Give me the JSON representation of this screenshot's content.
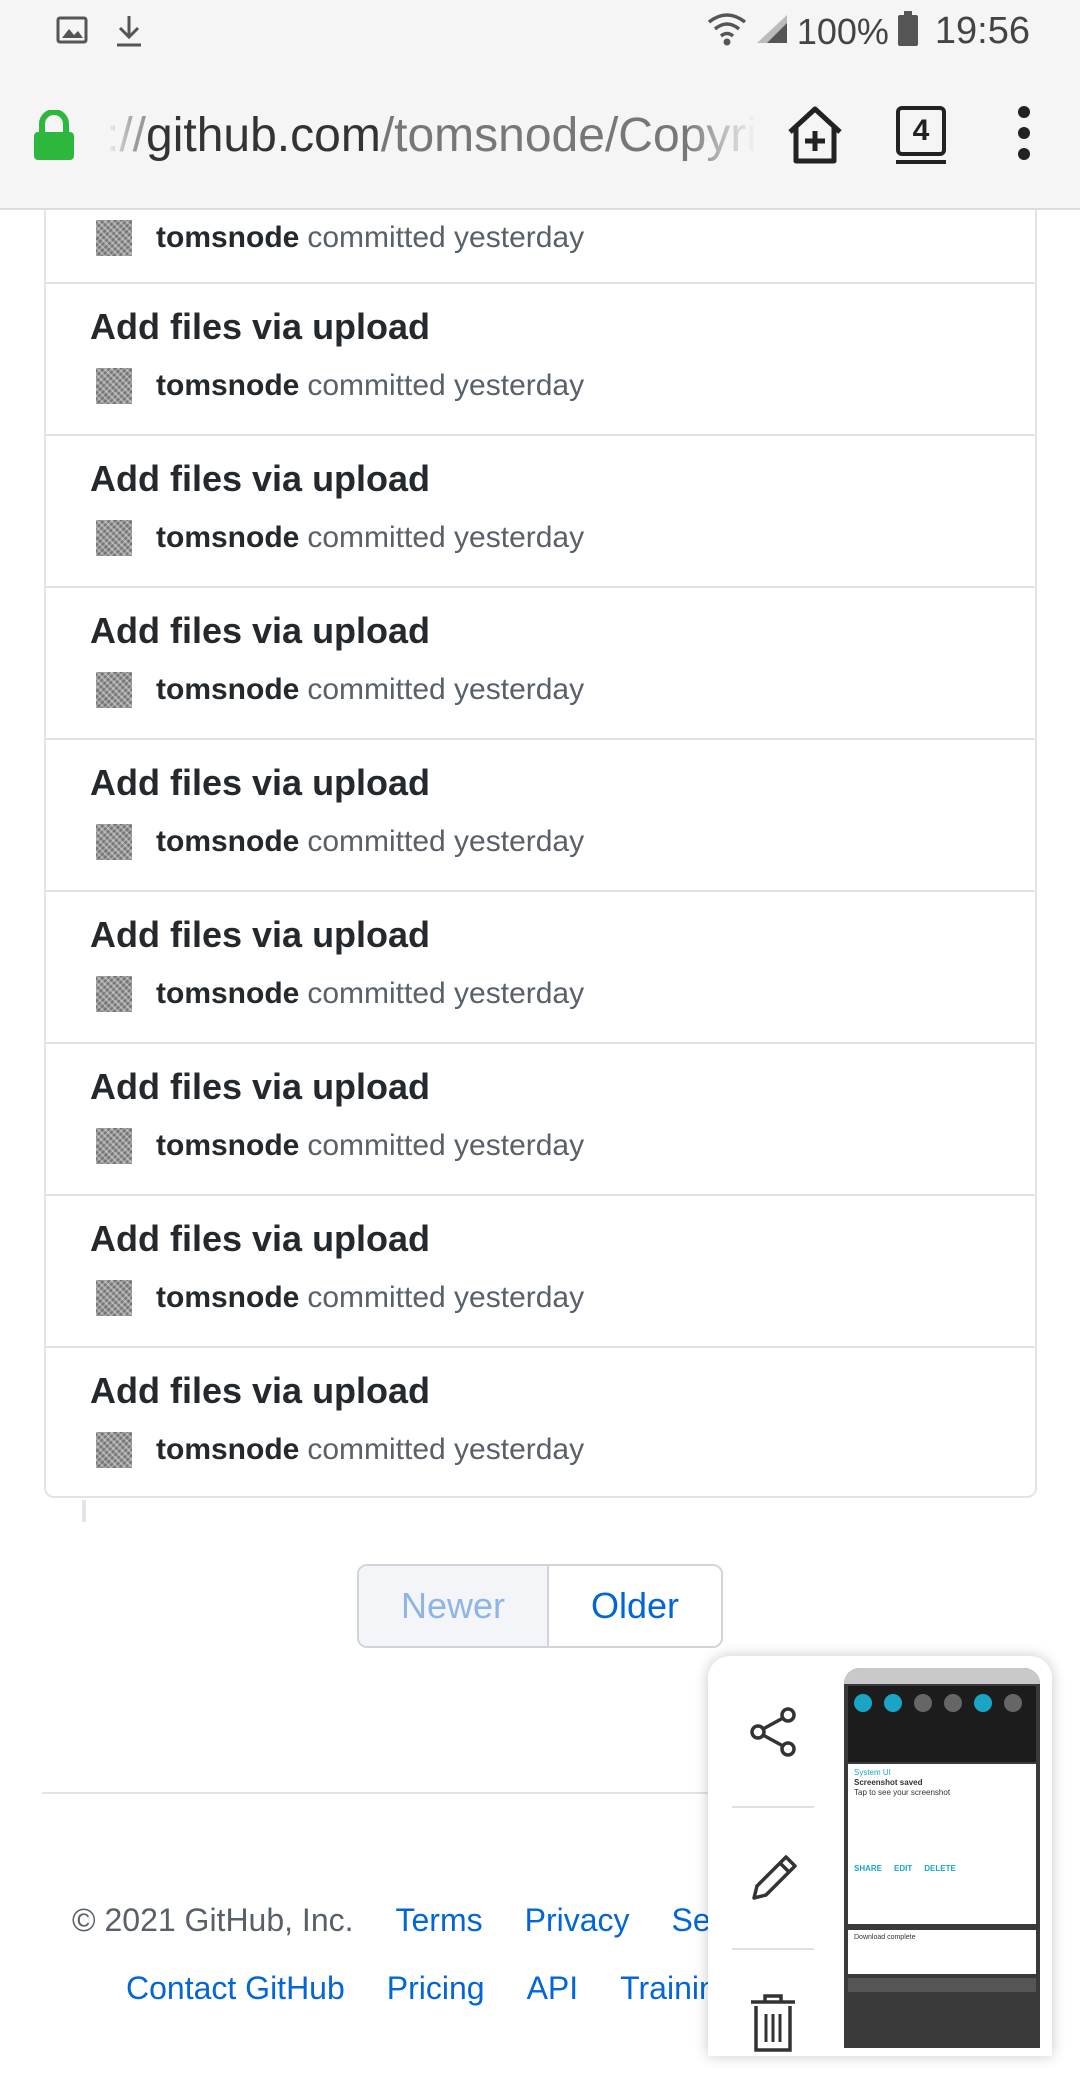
{
  "status_bar": {
    "battery": "100%",
    "time": "19:56"
  },
  "browser": {
    "url_prefix": "://",
    "url_host": "github.com",
    "url_path": "/tomsnode/Copyri",
    "tab_count": "4"
  },
  "commits": {
    "first_partial": {
      "author": "tomsnode",
      "committed": "committed yesterday"
    },
    "items": [
      {
        "title": "Add files via upload",
        "author": "tomsnode",
        "committed": "committed yesterday"
      },
      {
        "title": "Add files via upload",
        "author": "tomsnode",
        "committed": "committed yesterday"
      },
      {
        "title": "Add files via upload",
        "author": "tomsnode",
        "committed": "committed yesterday"
      },
      {
        "title": "Add files via upload",
        "author": "tomsnode",
        "committed": "committed yesterday"
      },
      {
        "title": "Add files via upload",
        "author": "tomsnode",
        "committed": "committed yesterday"
      },
      {
        "title": "Add files via upload",
        "author": "tomsnode",
        "committed": "committed yesterday"
      },
      {
        "title": "Add files via upload",
        "author": "tomsnode",
        "committed": "committed yesterday"
      },
      {
        "title": "Add files via upload",
        "author": "tomsnode",
        "committed": "committed yesterday"
      }
    ]
  },
  "pagination": {
    "newer": "Newer",
    "older": "Older"
  },
  "footer": {
    "copyright": "© 2021 GitHub, Inc.",
    "links_row1": [
      "Terms",
      "Privacy",
      "Sec"
    ],
    "links_row2": [
      "Contact GitHub",
      "Pricing",
      "API",
      "Trainin"
    ]
  },
  "screenshot_popup": {
    "actions": [
      "share-icon",
      "edit-icon",
      "delete-icon"
    ],
    "thumbnail": {
      "notif_app": "System UI",
      "notif_title": "Screenshot saved",
      "notif_body": "Tap to see your screenshot",
      "notif_actions": [
        "SHARE",
        "EDIT",
        "DELETE"
      ],
      "download_line": "Download complete"
    }
  },
  "colors": {
    "link": "#0366d6",
    "lock": "#2db83d",
    "border": "#e1e4e8"
  }
}
